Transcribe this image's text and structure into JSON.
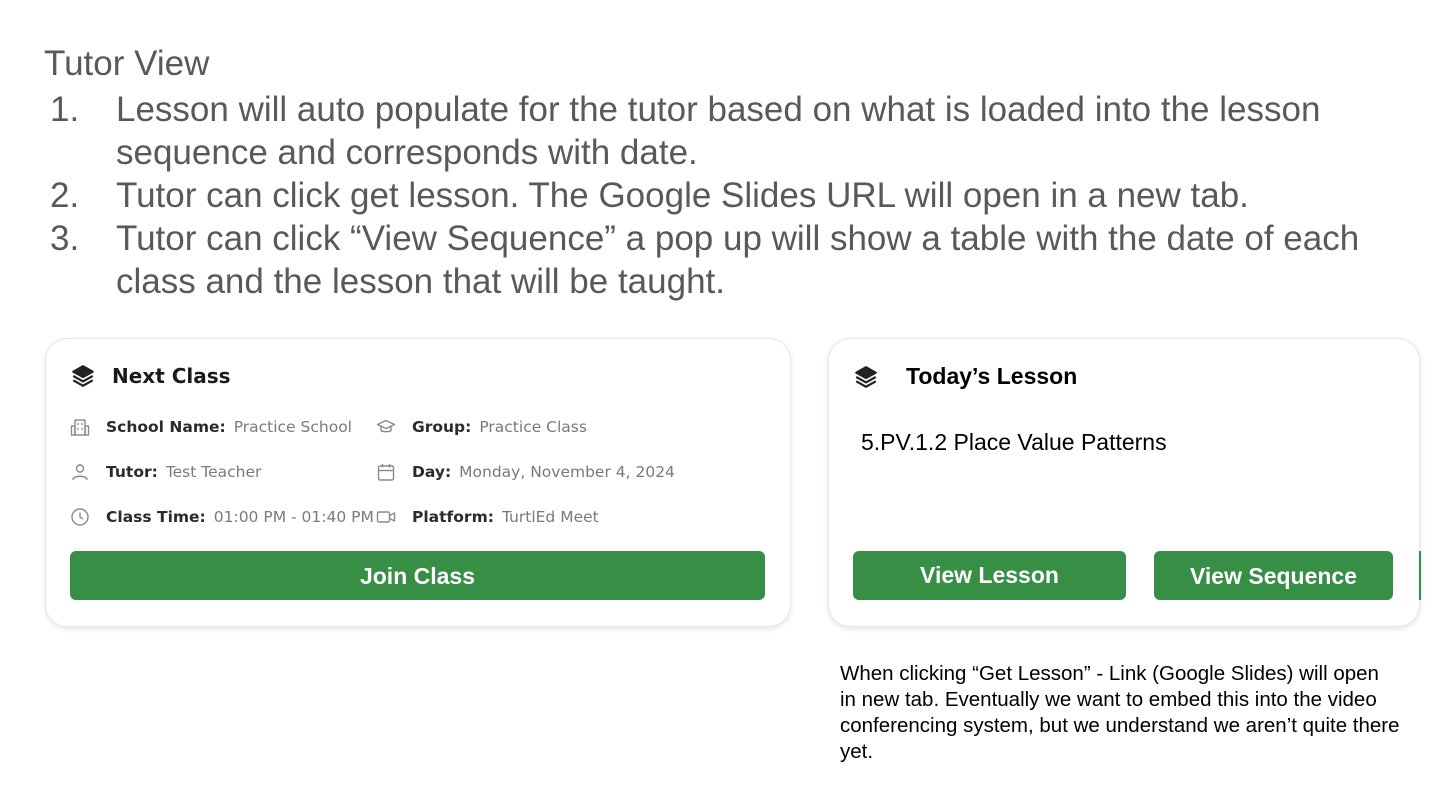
{
  "slide": {
    "title": "Tutor View",
    "steps": [
      {
        "num": "1.",
        "text": "Lesson will auto populate for the tutor based on what is loaded into the lesson sequence and corresponds with date."
      },
      {
        "num": "2.",
        "text": "Tutor can click get lesson. The Google Slides URL will open in a new tab."
      },
      {
        "num": "3.",
        "text": "Tutor can click “View Sequence” a pop up will show a table with the date of each class and the lesson that will be taught."
      }
    ]
  },
  "next_class": {
    "title": "Next Class",
    "school_label": "School Name:",
    "school_value": "Practice School",
    "group_label": "Group:",
    "group_value": "Practice Class",
    "tutor_label": "Tutor:",
    "tutor_value": "Test Teacher",
    "day_label": "Day:",
    "day_value": "Monday, November 4, 2024",
    "time_label": "Class Time:",
    "time_value": "01:00 PM - 01:40 PM",
    "platform_label": "Platform:",
    "platform_value": "TurtlEd Meet",
    "join_button": "Join Class"
  },
  "todays_lesson": {
    "title": "Today’s Lesson",
    "lesson_name": "5.PV.1.2 Place Value Patterns",
    "view_lesson_button": "View Lesson",
    "view_sequence_button": "View Sequence"
  },
  "note": "When clicking “Get Lesson” - Link (Google Slides) will open in new tab. Eventually we want to embed this into the video conferencing system, but we understand we aren’t quite there yet.",
  "colors": {
    "button_green": "#378e45",
    "heading_gray": "#595959"
  },
  "icons": [
    "layers-icon",
    "building-icon",
    "graduation-cap-icon",
    "user-icon",
    "calendar-icon",
    "clock-icon",
    "video-camera-icon"
  ]
}
